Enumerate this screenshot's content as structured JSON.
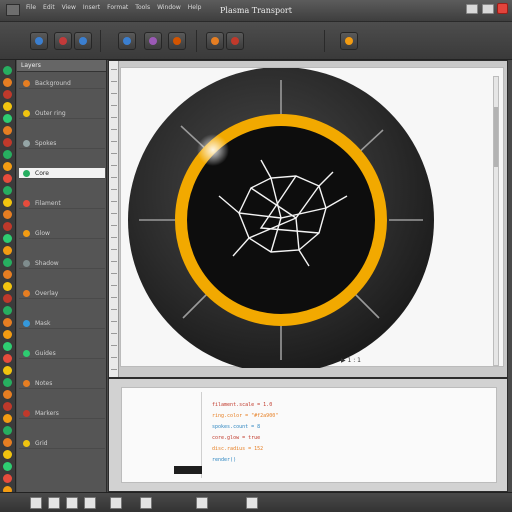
{
  "window": {
    "title": "Plasma Transport"
  },
  "menu": [
    "File",
    "Edit",
    "View",
    "Insert",
    "Format",
    "Tools",
    "Window",
    "Help"
  ],
  "toolbar": {
    "buttons": [
      {
        "name": "new-icon",
        "color": "#3b7fd0"
      },
      {
        "name": "open-icon",
        "color": "#c23a3a"
      },
      {
        "name": "save-icon",
        "color": "#3b7fd0"
      },
      {
        "name": "grid-icon",
        "color": "#3b7fd0"
      },
      {
        "name": "palette-icon",
        "color": "#9b59b6"
      },
      {
        "name": "image-icon",
        "color": "#d35400"
      },
      {
        "name": "record-icon",
        "color": "#e67e22"
      },
      {
        "name": "stop-icon",
        "color": "#c0392b"
      },
      {
        "name": "settings-icon",
        "color": "#f39c12"
      }
    ]
  },
  "side_panel": {
    "header": "Layers",
    "rows": [
      {
        "label": "Background",
        "color": "#e67e22"
      },
      {
        "label": "Outer ring",
        "color": "#f1c40f"
      },
      {
        "label": "Spokes",
        "color": "#95a5a6"
      },
      {
        "label": "Core",
        "color": "#27ae60"
      },
      {
        "label": "Filament",
        "color": "#e74c3c"
      },
      {
        "label": "Glow",
        "color": "#f39c12"
      },
      {
        "label": "Shadow",
        "color": "#7f8c8d"
      },
      {
        "label": "Overlay",
        "color": "#e67e22"
      },
      {
        "label": "Mask",
        "color": "#3498db"
      },
      {
        "label": "Guides",
        "color": "#2ecc71"
      },
      {
        "label": "Notes",
        "color": "#e67e22"
      },
      {
        "label": "Markers",
        "color": "#c0392b"
      },
      {
        "label": "Grid",
        "color": "#f1c40f"
      }
    ],
    "selected_index": 3
  },
  "canvas": {
    "ring_color": "#f2a900",
    "disc_color": "#2b2b2b",
    "filament_color": "#f4f4f4",
    "status": "▶  1 : 1"
  },
  "code": {
    "lines": [
      {
        "text": "filament.scale = 1.0",
        "color": "#c0392b"
      },
      {
        "text": "ring.color = \"#f2a900\"",
        "color": "#e67e22"
      },
      {
        "text": "spokes.count = 8",
        "color": "#2e86c1"
      },
      {
        "text": "core.glow = true",
        "color": "#c0392b"
      },
      {
        "text": "disc.radius = 152",
        "color": "#e67e22"
      },
      {
        "text": "render()",
        "color": "#2e86c1"
      }
    ]
  },
  "statusbar": {
    "buttons": [
      "prev-icon",
      "play-icon",
      "next-icon",
      "zoom-out-icon",
      "zoom-in-icon",
      "fit-icon",
      "layout-icon",
      "info-icon"
    ]
  }
}
